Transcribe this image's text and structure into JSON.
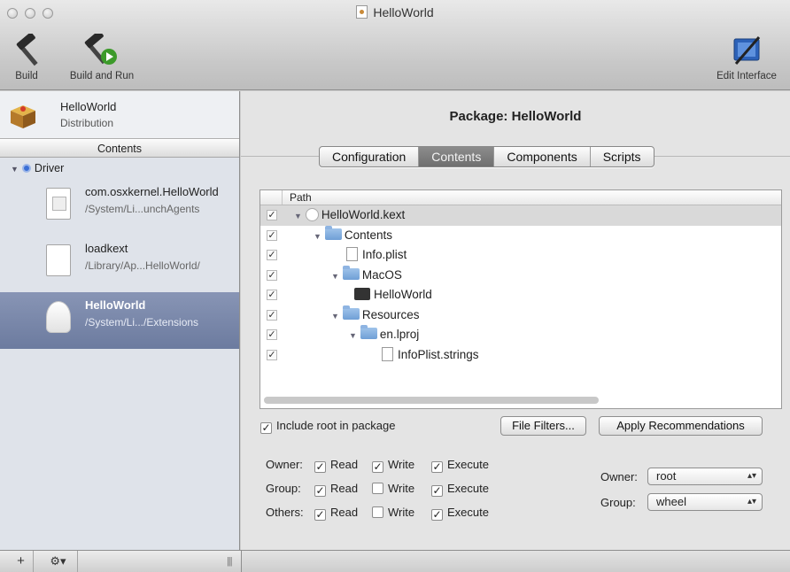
{
  "window": {
    "title": "HelloWorld"
  },
  "toolbar": {
    "build": "Build",
    "build_and_run": "Build and Run",
    "edit_interface": "Edit Interface"
  },
  "sidebar": {
    "project": {
      "name": "HelloWorld",
      "subtitle": "Distribution"
    },
    "contents_header": "Contents",
    "group": "Driver",
    "items": [
      {
        "name": "com.osxkernel.HelloWorld",
        "path": "/System/Li...unchAgents"
      },
      {
        "name": "loadkext",
        "path": "/Library/Ap...HelloWorld/"
      },
      {
        "name": "HelloWorld",
        "path": "/System/Li.../Extensions"
      }
    ]
  },
  "bottombar": {
    "add": "+",
    "gear": "⚙▾",
    "grip": "|||"
  },
  "main": {
    "title": "Package: HelloWorld",
    "tabs": [
      "Configuration",
      "Contents",
      "Components",
      "Scripts"
    ],
    "active_tab": "Contents",
    "tree": {
      "column": "Path",
      "rows": [
        {
          "label": "HelloWorld.kext",
          "checked": true
        },
        {
          "label": "Contents",
          "checked": true
        },
        {
          "label": "Info.plist",
          "checked": true
        },
        {
          "label": "MacOS",
          "checked": true
        },
        {
          "label": "HelloWorld",
          "checked": true
        },
        {
          "label": "Resources",
          "checked": true
        },
        {
          "label": "en.lproj",
          "checked": true
        },
        {
          "label": "InfoPlist.strings",
          "checked": true
        }
      ]
    },
    "include_root": "Include root in package",
    "file_filters": "File Filters...",
    "apply_recommendations": "Apply Recommendations",
    "permissions": {
      "owner_label": "Owner:",
      "group_label": "Group:",
      "others_label": "Others:",
      "read": "Read",
      "write": "Write",
      "execute": "Execute",
      "owner": {
        "read": true,
        "write": true,
        "execute": true
      },
      "group": {
        "read": true,
        "write": false,
        "execute": true
      },
      "others": {
        "read": true,
        "write": false,
        "execute": true
      }
    },
    "owner_select": {
      "label": "Owner:",
      "value": "root"
    },
    "group_select": {
      "label": "Group:",
      "value": "wheel"
    }
  },
  "checkmark": "✓"
}
